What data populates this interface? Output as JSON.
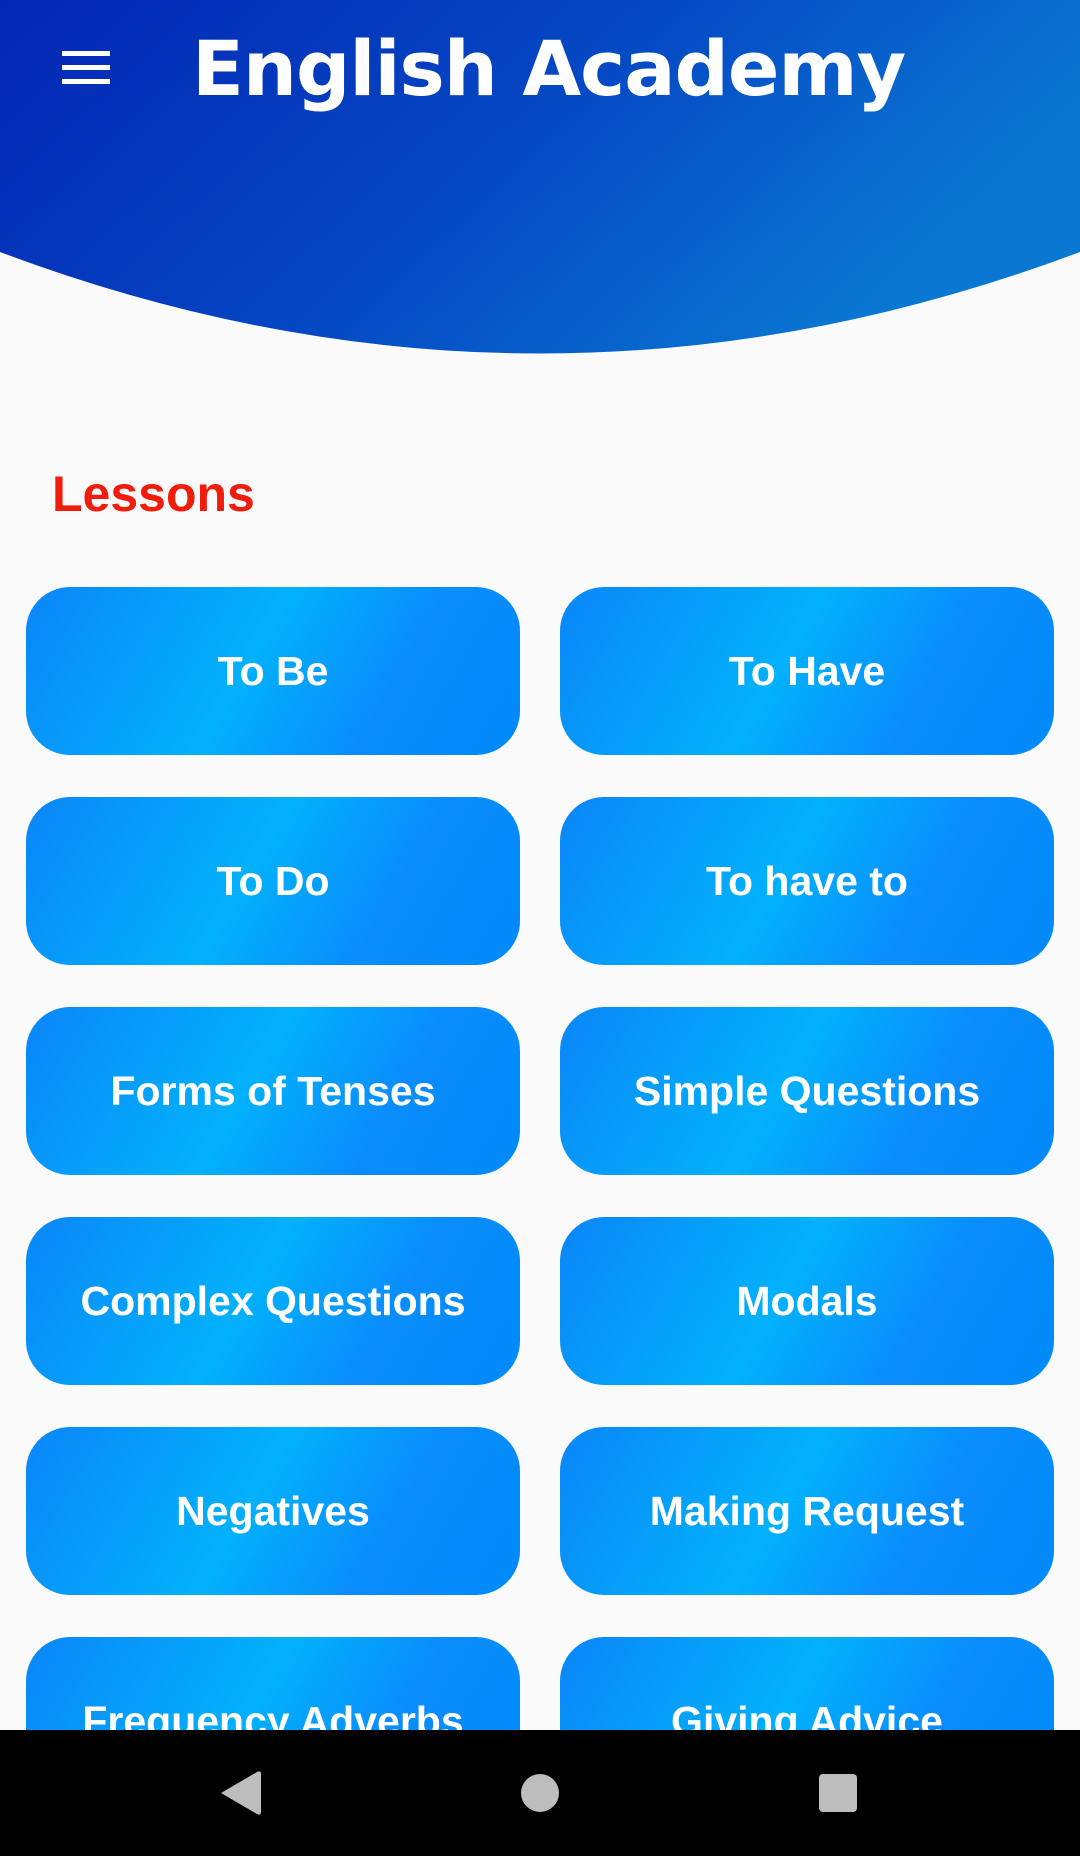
{
  "app": {
    "title": "English Academy",
    "menu_icon": "hamburger-menu-icon",
    "header_gradient": [
      "#0426b4",
      "#0554c6",
      "#0a78d2"
    ]
  },
  "section": {
    "title": "Lessons",
    "title_color": "#f01c0c"
  },
  "lessons": [
    {
      "label": "To Be"
    },
    {
      "label": "To Have"
    },
    {
      "label": "To Do"
    },
    {
      "label": "To have to"
    },
    {
      "label": "Forms of Tenses"
    },
    {
      "label": "Simple Questions"
    },
    {
      "label": "Complex Questions"
    },
    {
      "label": "Modals"
    },
    {
      "label": "Negatives"
    },
    {
      "label": "Making Request"
    },
    {
      "label": "Frequency Adverbs"
    },
    {
      "label": "Giving Advice"
    }
  ],
  "lesson_button_colors": [
    "#0a86f8",
    "#02b1fb",
    "#008afa"
  ],
  "navigation": {
    "back_icon": "back-triangle-icon",
    "home_icon": "home-circle-icon",
    "recents_icon": "recents-square-icon"
  }
}
